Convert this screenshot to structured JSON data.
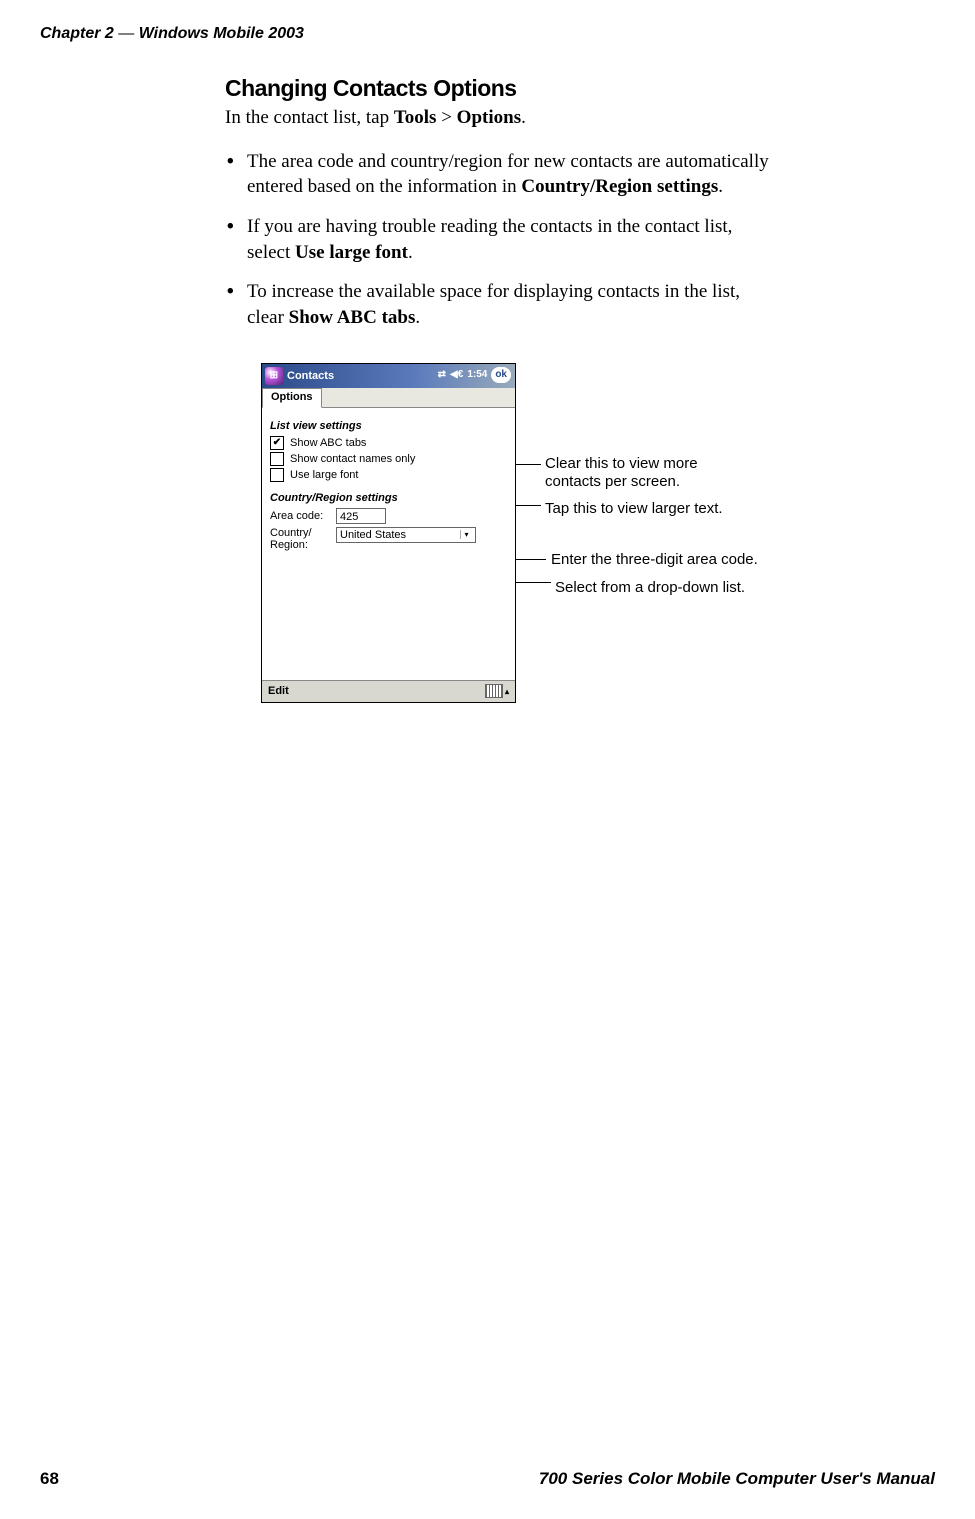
{
  "header": {
    "chapter": "Chapter 2",
    "dash": "—",
    "title": "Windows Mobile 2003"
  },
  "section": {
    "title": "Changing Contacts Options",
    "intro_pre": "In the contact list, tap ",
    "intro_b1": "Tools",
    "intro_mid": " > ",
    "intro_b2": "Options",
    "intro_post": ".",
    "bullets": [
      {
        "pre": "The area code and country/region for new contacts are automatically entered based on the information in ",
        "bold": "Country/Region settings",
        "post": "."
      },
      {
        "pre": "If you are having trouble reading the contacts in the contact list, select ",
        "bold": "Use large font",
        "post": "."
      },
      {
        "pre": "To increase the available space for displaying contacts in the list, clear ",
        "bold": "Show ABC tabs",
        "post": "."
      }
    ]
  },
  "device": {
    "title": "Contacts",
    "time": "1:54",
    "ok": "ok",
    "tab": "Options",
    "group1": "List view settings",
    "chk_abc": "Show ABC tabs",
    "chk_names": "Show contact names only",
    "chk_large": "Use large font",
    "group2": "Country/Region settings",
    "area_label": "Area code:",
    "area_value": "425",
    "country_label": "Country/\nRegion:",
    "country_value": "United States",
    "edit": "Edit"
  },
  "callouts": {
    "c1a": "Clear this to view more",
    "c1b": "contacts per screen.",
    "c2": "Tap this to view larger text.",
    "c3": "Enter the three-digit area code.",
    "c4": "Select from a drop-down list."
  },
  "footer": {
    "page": "68",
    "title": "700 Series Color Mobile Computer User's Manual"
  }
}
